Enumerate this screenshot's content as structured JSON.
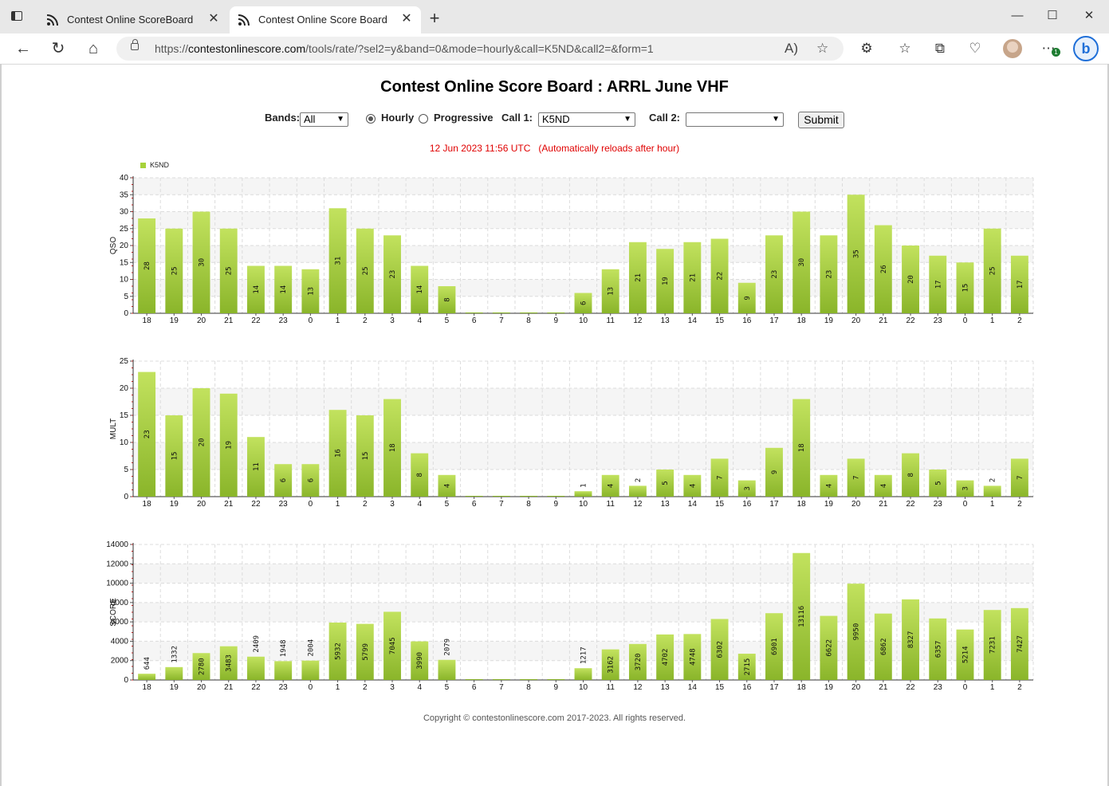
{
  "browser": {
    "tabs": [
      {
        "label": "Contest Online ScoreBoard",
        "active": false
      },
      {
        "label": "Contest Online Score Board",
        "active": true
      }
    ],
    "url_prefix": "https://",
    "url_host": "contestonlinescore.com",
    "url_path": "/tools/rate/?sel2=y&band=0&mode=hourly&call=K5ND&call2=&form=1",
    "extension_badge": "1"
  },
  "page": {
    "title": "Contest Online Score Board : ARRL June VHF",
    "bands_label": "Bands:",
    "bands_value": "All",
    "hourly_label": "Hourly",
    "progressive_label": "Progressive",
    "mode_selected": "Hourly",
    "call1_label": "Call 1:",
    "call1_value": "K5ND",
    "call2_label": "Call 2:",
    "call2_value": "",
    "submit_label": "Submit",
    "status": "12 Jun 2023 11:56 UTC   (Automatically reloads after hour)",
    "copyright": "Copyright © contestonlinescore.com 2017-2023. All rights reserved."
  },
  "colors": {
    "bar_top": "#c2e25e",
    "bar_bottom": "#8ab52a",
    "status_text": "#e00000",
    "grid": "#dcdcdc",
    "tick_mark": "#d11a1a"
  },
  "chart_data": [
    {
      "type": "bar",
      "legend": [
        "K5ND"
      ],
      "ylabel": "QSO",
      "ylim": [
        0,
        40
      ],
      "yticks": [
        0,
        5,
        10,
        15,
        20,
        25,
        30,
        35,
        40
      ],
      "categories": [
        "18",
        "19",
        "20",
        "21",
        "22",
        "23",
        "0",
        "1",
        "2",
        "3",
        "4",
        "5",
        "6",
        "7",
        "8",
        "9",
        "10",
        "11",
        "12",
        "13",
        "14",
        "15",
        "16",
        "17",
        "18",
        "19",
        "20",
        "21",
        "22",
        "23",
        "0",
        "1",
        "2"
      ],
      "series": [
        {
          "name": "K5ND",
          "values": [
            28,
            25,
            30,
            25,
            14,
            14,
            13,
            31,
            25,
            23,
            14,
            8,
            0,
            0,
            0,
            0,
            6,
            13,
            21,
            19,
            21,
            22,
            9,
            23,
            30,
            23,
            35,
            26,
            20,
            17,
            15,
            25,
            17
          ]
        }
      ]
    },
    {
      "type": "bar",
      "ylabel": "MULT",
      "ylim": [
        0,
        25
      ],
      "yticks": [
        0,
        5,
        10,
        15,
        20,
        25
      ],
      "categories": [
        "18",
        "19",
        "20",
        "21",
        "22",
        "23",
        "0",
        "1",
        "2",
        "3",
        "4",
        "5",
        "6",
        "7",
        "8",
        "9",
        "10",
        "11",
        "12",
        "13",
        "14",
        "15",
        "16",
        "17",
        "18",
        "19",
        "20",
        "21",
        "22",
        "23",
        "0",
        "1",
        "2"
      ],
      "series": [
        {
          "name": "K5ND",
          "values": [
            23,
            15,
            20,
            19,
            11,
            6,
            6,
            16,
            15,
            18,
            8,
            4,
            0,
            0,
            0,
            0,
            1,
            4,
            2,
            5,
            4,
            7,
            3,
            9,
            18,
            4,
            7,
            4,
            8,
            5,
            3,
            2,
            7
          ]
        }
      ]
    },
    {
      "type": "bar",
      "ylabel": "SCORE",
      "ylim": [
        0,
        14000
      ],
      "yticks": [
        0,
        2000,
        4000,
        6000,
        8000,
        10000,
        12000,
        14000
      ],
      "categories": [
        "18",
        "19",
        "20",
        "21",
        "22",
        "23",
        "0",
        "1",
        "2",
        "3",
        "4",
        "5",
        "6",
        "7",
        "8",
        "9",
        "10",
        "11",
        "12",
        "13",
        "14",
        "15",
        "16",
        "17",
        "18",
        "19",
        "20",
        "21",
        "22",
        "23",
        "0",
        "1",
        "2"
      ],
      "series": [
        {
          "name": "K5ND",
          "values": [
            644,
            1332,
            2780,
            3483,
            2409,
            1948,
            2004,
            5932,
            5799,
            7045,
            3990,
            2079,
            0,
            0,
            0,
            0,
            1217,
            3162,
            3720,
            4702,
            4748,
            6302,
            2715,
            6901,
            13116,
            6622,
            9950,
            6862,
            8327,
            6357,
            5214,
            7231,
            7427
          ]
        }
      ]
    }
  ]
}
